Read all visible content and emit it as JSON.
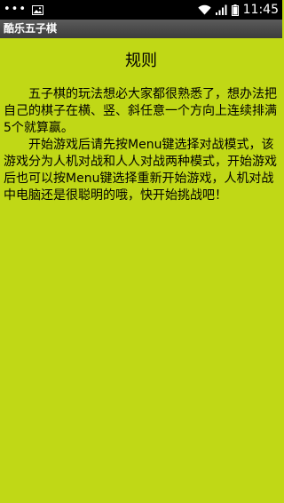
{
  "status_bar": {
    "dots": "•••",
    "time": "11:45",
    "icons": [
      "image-icon",
      "wifi-icon",
      "signal-icon",
      "battery-icon"
    ]
  },
  "app": {
    "title": "酷乐五子棋"
  },
  "rules": {
    "heading": "规则",
    "paragraphs": [
      "五子棋的玩法想必大家都很熟悉了，想办法把自己的棋子在横、竖、斜任意一个方向上连续排满5个就算赢。",
      "开始游戏后请先按Menu键选择对战模式，该游戏分为人机对战和人人对战两种模式，开始游戏后也可以按Menu键选择重新开始游戏，人机对战中电脑还是很聪明的哦，快开始挑战吧！"
    ]
  },
  "colors": {
    "background": "#c0d816",
    "status_bar": "#000000",
    "title_bar": "#4a4a4a"
  }
}
